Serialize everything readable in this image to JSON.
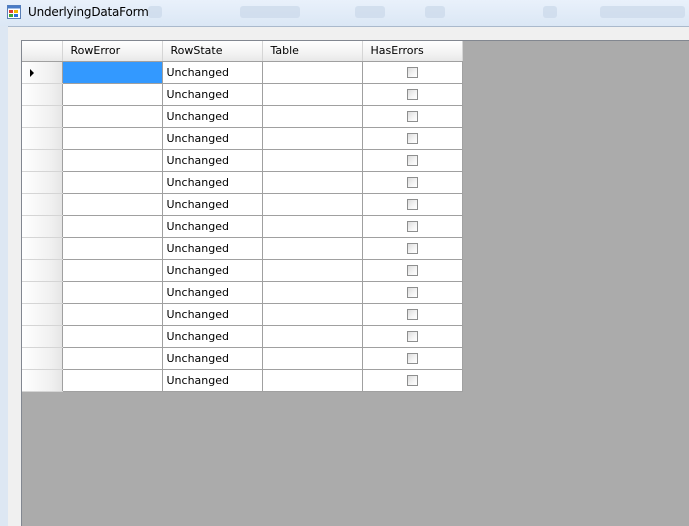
{
  "window": {
    "title": "UnderlyingDataForm"
  },
  "grid": {
    "columns": [
      "RowError",
      "RowState",
      "Table",
      "HasErrors"
    ],
    "rows": [
      {
        "row_error": "",
        "row_state": "Unchanged",
        "table": "",
        "has_errors": false
      },
      {
        "row_error": "",
        "row_state": "Unchanged",
        "table": "",
        "has_errors": false
      },
      {
        "row_error": "",
        "row_state": "Unchanged",
        "table": "",
        "has_errors": false
      },
      {
        "row_error": "",
        "row_state": "Unchanged",
        "table": "",
        "has_errors": false
      },
      {
        "row_error": "",
        "row_state": "Unchanged",
        "table": "",
        "has_errors": false
      },
      {
        "row_error": "",
        "row_state": "Unchanged",
        "table": "",
        "has_errors": false
      },
      {
        "row_error": "",
        "row_state": "Unchanged",
        "table": "",
        "has_errors": false
      },
      {
        "row_error": "",
        "row_state": "Unchanged",
        "table": "",
        "has_errors": false
      },
      {
        "row_error": "",
        "row_state": "Unchanged",
        "table": "",
        "has_errors": false
      },
      {
        "row_error": "",
        "row_state": "Unchanged",
        "table": "",
        "has_errors": false
      },
      {
        "row_error": "",
        "row_state": "Unchanged",
        "table": "",
        "has_errors": false
      },
      {
        "row_error": "",
        "row_state": "Unchanged",
        "table": "",
        "has_errors": false
      },
      {
        "row_error": "",
        "row_state": "Unchanged",
        "table": "",
        "has_errors": false
      },
      {
        "row_error": "",
        "row_state": "Unchanged",
        "table": "",
        "has_errors": false
      },
      {
        "row_error": "",
        "row_state": "Unchanged",
        "table": "",
        "has_errors": false
      }
    ],
    "current_row_index": 0,
    "selection_color": "#3399ff",
    "background_color": "#ababab"
  },
  "icons": {
    "app": "windows-form-icon",
    "current_row": "row-pointer-arrow-icon"
  }
}
